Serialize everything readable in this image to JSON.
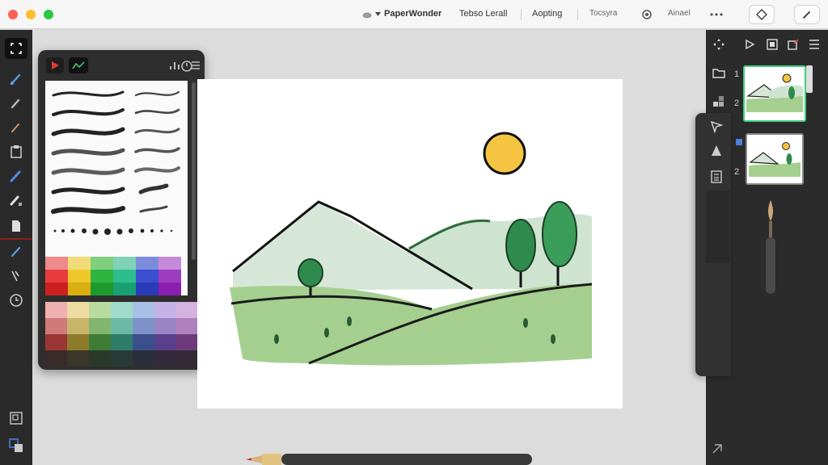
{
  "titlebar": {
    "app_name": "PaperWonder",
    "menu_1": "Tebso Lerall",
    "menu_2": "Aopting",
    "menu_3": "Tocsyra",
    "menu_4": "Ainael"
  },
  "icons": {
    "app_icon": "cloud-icon",
    "dropdown": "chevron-down-icon",
    "settings": "gear-icon",
    "more": "more-icon",
    "adjust": "diamond-move-icon",
    "pen": "pen-icon"
  },
  "left_tools": [
    {
      "name": "transform-tool",
      "icon": "selection-icon"
    },
    {
      "name": "brush-tool",
      "icon": "brush-icon"
    },
    {
      "name": "smudge-tool",
      "icon": "smudge-icon"
    },
    {
      "name": "dropper-tool",
      "icon": "eyedropper-icon"
    },
    {
      "name": "paste-tool",
      "icon": "clipboard-icon"
    },
    {
      "name": "pencil-tool",
      "icon": "pencil-icon"
    },
    {
      "name": "eraser-tool",
      "icon": "eraser-icon"
    },
    {
      "name": "file-tool",
      "icon": "file-icon"
    },
    {
      "name": "pen-tool",
      "icon": "pen-icon"
    },
    {
      "name": "bucket-tool",
      "icon": "bucket-icon"
    },
    {
      "name": "timer-tool",
      "icon": "clock-icon"
    },
    {
      "name": "layers-tool",
      "icon": "layers-icon"
    },
    {
      "name": "color-tool",
      "icon": "color-squares-icon"
    }
  ],
  "layers": {
    "layer_1_label": "1",
    "layer_2_label": "2",
    "layer_3_label": "2"
  },
  "colors": {
    "accent_green": "#28c840",
    "sun": "#f5c542",
    "hill_green": "#9ccb86",
    "tree_green": "#2e7d46",
    "mountain": "#cfe0d0"
  }
}
